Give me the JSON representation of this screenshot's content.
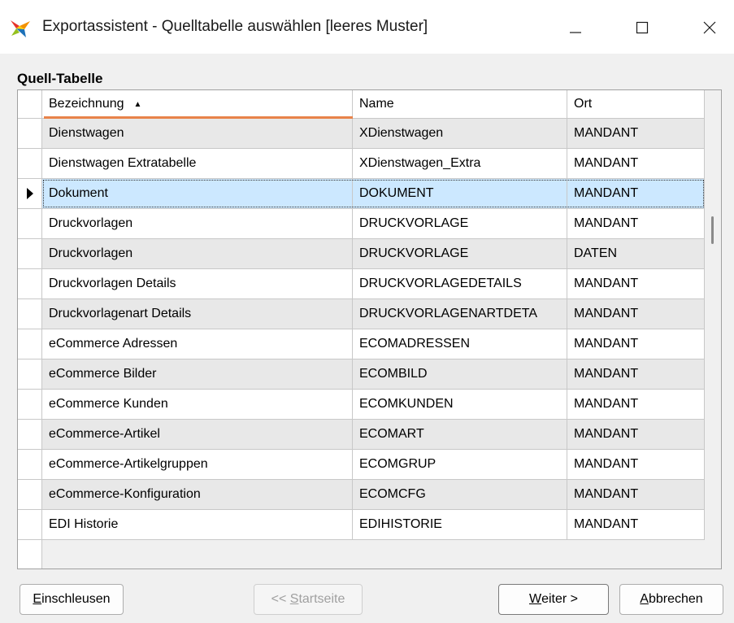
{
  "window": {
    "title": "Exportassistent - Quelltabelle auswählen [leeres Muster]",
    "controls": [
      "minimize",
      "maximize",
      "close"
    ]
  },
  "section_label": "Quell-Tabelle",
  "table": {
    "columns": [
      "Bezeichnung",
      "Name",
      "Ort"
    ],
    "sort_column": "Bezeichnung",
    "sort_direction": "ascending",
    "selected_row": 2,
    "rows": [
      [
        "Dienstwagen",
        "XDienstwagen",
        "MANDANT"
      ],
      [
        "Dienstwagen Extratabelle",
        "XDienstwagen_Extra",
        "MANDANT"
      ],
      [
        "Dokument",
        "DOKUMENT",
        "MANDANT"
      ],
      [
        "Druckvorlagen",
        "DRUCKVORLAGE",
        "MANDANT"
      ],
      [
        "Druckvorlagen",
        "DRUCKVORLAGE",
        "DATEN"
      ],
      [
        "Druckvorlagen Details",
        "DRUCKVORLAGEDETAILS",
        "MANDANT"
      ],
      [
        "Druckvorlagenart Details",
        "DRUCKVORLAGENARTDETA",
        "MANDANT"
      ],
      [
        "eCommerce Adressen",
        "ECOMADRESSEN",
        "MANDANT"
      ],
      [
        "eCommerce Bilder",
        "ECOMBILD",
        "MANDANT"
      ],
      [
        "eCommerce Kunden",
        "ECOMKUNDEN",
        "MANDANT"
      ],
      [
        "eCommerce-Artikel",
        "ECOMART",
        "MANDANT"
      ],
      [
        "eCommerce-Artikelgruppen",
        "ECOMGRUP",
        "MANDANT"
      ],
      [
        "eCommerce-Konfiguration",
        "ECOMCFG",
        "MANDANT"
      ],
      [
        "EDI Historie",
        "EDIHISTORIE",
        "MANDANT"
      ]
    ]
  },
  "buttons": {
    "einschleusen": {
      "mnemonic": "E",
      "rest": "inschleusen"
    },
    "startseite": {
      "prefix": "<< ",
      "mnemonic": "S",
      "rest": "tartseite"
    },
    "weiter": {
      "mnemonic": "W",
      "rest": "eiter >"
    },
    "abbrechen": {
      "mnemonic": "A",
      "rest": "bbrechen"
    }
  },
  "colors": {
    "selected_row": "#cce8ff",
    "alt_row": "#e8e8e8",
    "sort_indicator": "#e8834a"
  }
}
